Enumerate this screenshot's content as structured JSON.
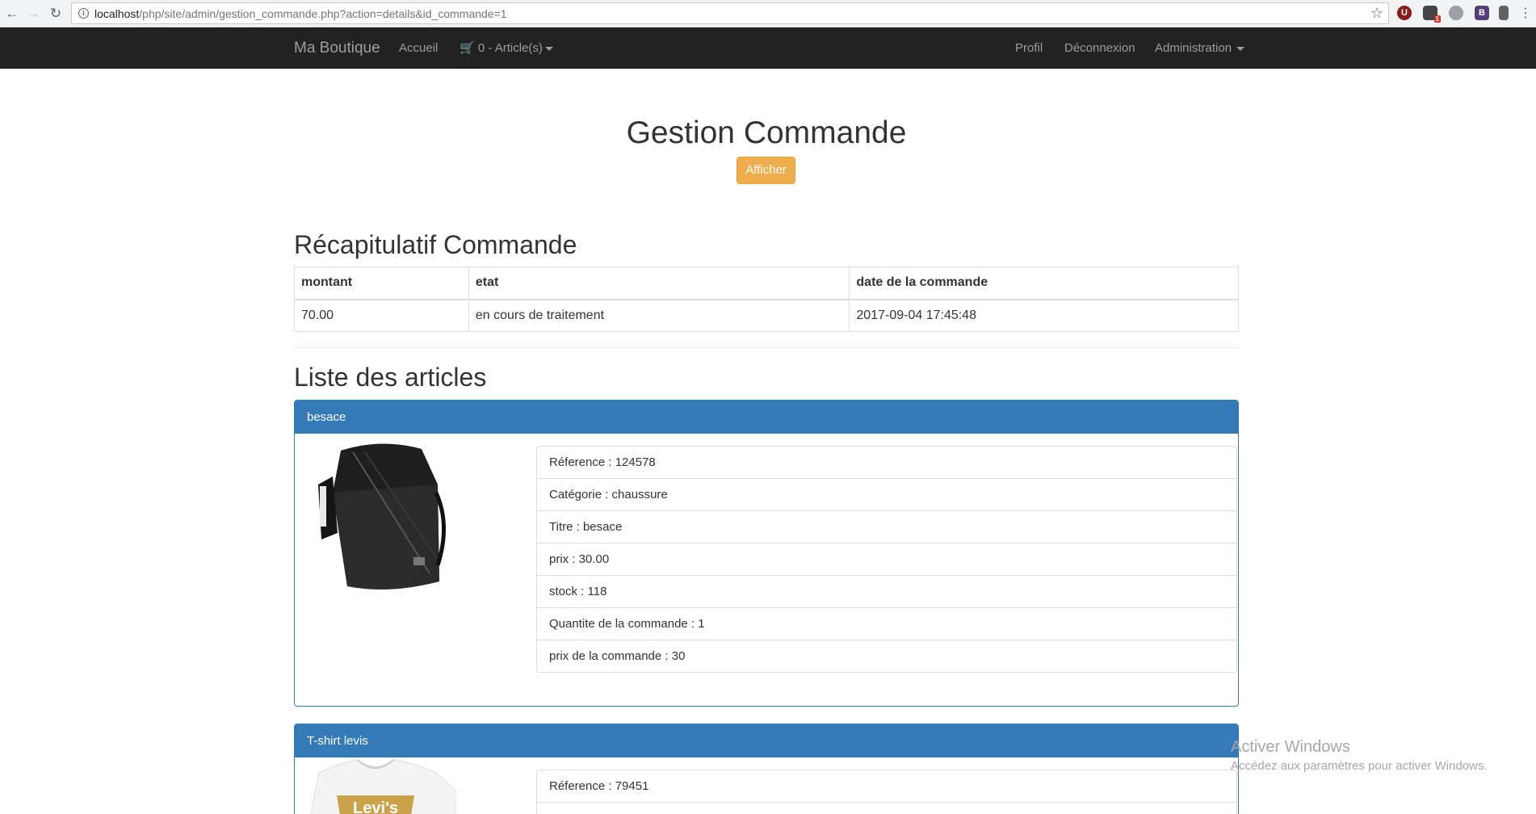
{
  "browser": {
    "url_host": "localhost",
    "url_path": "/php/site/admin/gestion_commande.php?action=details&id_commande=1",
    "extension_badge": "1"
  },
  "navbar": {
    "brand": "Ma Boutique",
    "home": "Accueil",
    "cart": "0 - Article(s)",
    "profile": "Profil",
    "logout": "Déconnexion",
    "admin": "Administration"
  },
  "page": {
    "title": "Gestion Commande",
    "show_button": "Afficher"
  },
  "summary": {
    "title": "Récapitulatif Commande",
    "headers": [
      "montant",
      "etat",
      "date de la commande"
    ],
    "row": [
      "70.00",
      "en cours de traitement",
      "2017-09-04 17:45:48"
    ]
  },
  "articles": {
    "title": "Liste des articles",
    "items": [
      {
        "name": "besace",
        "details": [
          "Réference : 124578",
          "Catégorie : chaussure",
          "Titre : besace",
          "prix : 30.00",
          "stock : 118",
          "Quantite de la commande : 1",
          "prix de la commande : 30"
        ]
      },
      {
        "name": "T-shirt levis",
        "image_text": "Levi's",
        "details": [
          "Réference : 79451"
        ]
      }
    ]
  },
  "watermark": {
    "title": "Activer Windows",
    "subtitle": "Accédez aux paramètres pour activer Windows."
  },
  "colors": {
    "navbar_bg": "#222222",
    "primary": "#337ab7",
    "warning": "#f0ad4e"
  }
}
